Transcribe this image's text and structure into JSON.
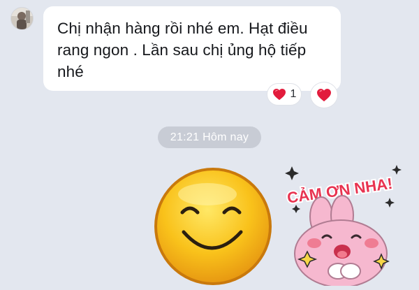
{
  "message": {
    "text_lines": [
      "Chị nhận hàng rồi nhé em. Hạt điều",
      "rang ngon . Lần sau chị ủng hộ tiếp",
      "nhé"
    ],
    "reaction_icon": "heart-icon",
    "reaction_count": "1",
    "react_button_icon": "heart-icon"
  },
  "timestamp": "21:21 Hôm nay",
  "sticker": {
    "text": "CẢM ƠN NHA!"
  },
  "colors": {
    "background": "#e3e7ef",
    "bubble": "#ffffff",
    "heart": "#e21b3c",
    "time_pill": "#c8ccd5"
  }
}
